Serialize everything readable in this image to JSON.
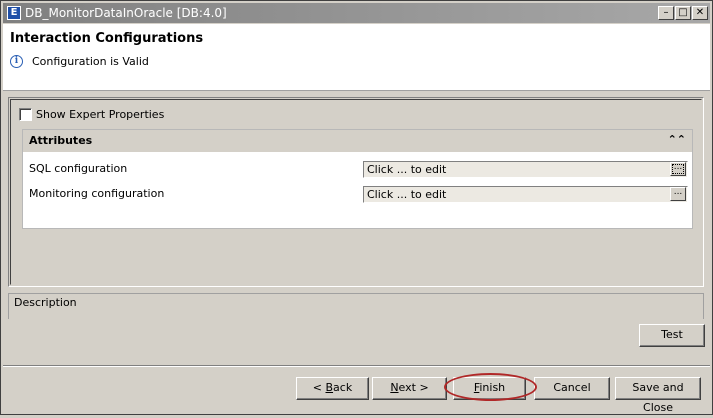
{
  "window": {
    "title": "DB_MonitorDataInOracle [DB:4.0]",
    "icon": "app-icon"
  },
  "header": {
    "title": "Interaction Configurations",
    "status": "Configuration is Valid"
  },
  "options": {
    "expert_label": "Show Expert Properties",
    "expert_checked": false
  },
  "attributes": {
    "title": "Attributes",
    "rows": [
      {
        "label": "SQL configuration",
        "value": "Click ... to edit"
      },
      {
        "label": "Monitoring configuration",
        "value": "Click ... to edit"
      }
    ]
  },
  "description": {
    "title": "Description"
  },
  "buttons": {
    "test": "Test",
    "back_prefix": "< ",
    "back_key": "B",
    "back_rest": "ack",
    "next_key": "N",
    "next_rest": "ext >",
    "finish_key": "F",
    "finish_rest": "inish",
    "cancel": "Cancel",
    "save_close": "Save and Close"
  },
  "colors": {
    "highlight": "#b02828",
    "info": "#2a5fb4"
  }
}
